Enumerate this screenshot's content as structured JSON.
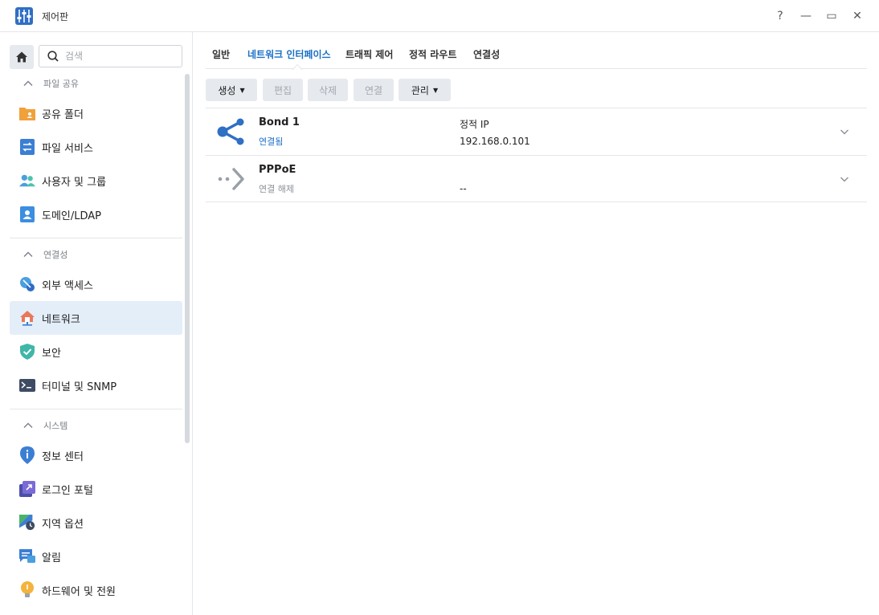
{
  "window": {
    "title": "제어판",
    "buttons": {
      "help": "?",
      "minimize": "—",
      "maximize": "▭",
      "close": "✕"
    }
  },
  "sidebar": {
    "search_placeholder": "검색",
    "sections": [
      {
        "title": "파일 공유",
        "items": [
          {
            "label": "공유 폴더",
            "icon": "shared-folder-icon"
          },
          {
            "label": "파일 서비스",
            "icon": "file-services-icon"
          },
          {
            "label": "사용자 및 그룹",
            "icon": "user-group-icon"
          },
          {
            "label": "도메인/LDAP",
            "icon": "domain-ldap-icon"
          }
        ]
      },
      {
        "title": "연결성",
        "items": [
          {
            "label": "외부 액세스",
            "icon": "external-access-icon"
          },
          {
            "label": "네트워크",
            "icon": "network-icon",
            "active": true
          },
          {
            "label": "보안",
            "icon": "security-shield-icon"
          },
          {
            "label": "터미널 및 SNMP",
            "icon": "terminal-icon"
          }
        ]
      },
      {
        "title": "시스템",
        "items": [
          {
            "label": "정보 센터",
            "icon": "info-center-icon"
          },
          {
            "label": "로그인 포털",
            "icon": "login-portal-icon"
          },
          {
            "label": "지역 옵션",
            "icon": "regional-options-icon"
          },
          {
            "label": "알림",
            "icon": "notification-icon"
          },
          {
            "label": "하드웨어 및 전원",
            "icon": "hardware-power-icon"
          }
        ]
      }
    ]
  },
  "tabs": [
    {
      "label": "일반"
    },
    {
      "label": "네트워크 인터페이스",
      "active": true
    },
    {
      "label": "트래픽 제어"
    },
    {
      "label": "정적 라우트"
    },
    {
      "label": "연결성"
    }
  ],
  "toolbar": {
    "create": "생성",
    "edit": "편집",
    "delete": "삭제",
    "connect": "연결",
    "manage": "관리"
  },
  "interfaces": [
    {
      "name": "Bond 1",
      "status": "연결됨",
      "ip_label": "정적 IP",
      "ip_value": "192.168.0.101",
      "connected": true
    },
    {
      "name": "PPPoE",
      "status": "연결 해제",
      "ip_label": "",
      "ip_value": "--",
      "connected": false
    }
  ],
  "colors": {
    "accent": "#1b6fc6",
    "active_bg": "#e4eef9"
  }
}
